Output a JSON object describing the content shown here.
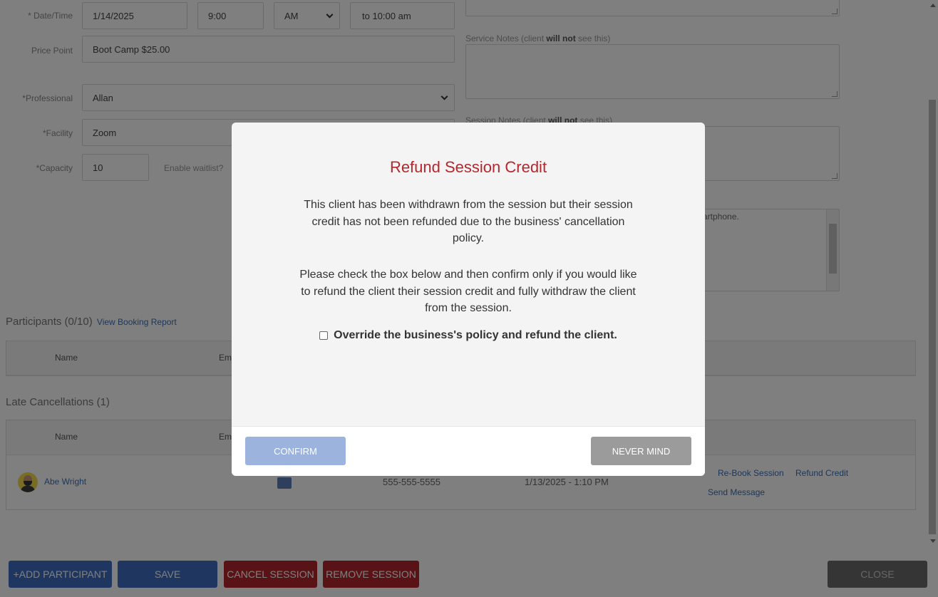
{
  "form": {
    "date_label": "* Date/Time",
    "date_value": "1/14/2025",
    "time_value": "9:00",
    "ampm_value": "AM",
    "end_time": "to 10:00 am",
    "price_label": "Price Point",
    "price_value": "Boot Camp $25.00",
    "professional_label": "*Professional",
    "professional_value": "Allan",
    "facility_label": "*Facility",
    "facility_value": "Zoom",
    "capacity_label": "*Capacity",
    "capacity_value": "10",
    "waitlist_label": "Enable waitlist?"
  },
  "notes": {
    "service_prefix": "Service Notes (client ",
    "service_bold": "will not",
    "service_suffix": " see this)",
    "session_prefix": "Session Notes (client ",
    "session_bold": "will not",
    "session_suffix": " see this)",
    "extra_text": "artphone."
  },
  "participants": {
    "title": "Participants (0/10)",
    "report_link": "View Booking Report",
    "col_name": "Name",
    "col_email": "Em"
  },
  "late_cancellations": {
    "title": "Late Cancellations (1)",
    "col_name": "Name",
    "col_email": "Em",
    "row": {
      "name": "Abe Wright",
      "phone": "555-555-5555",
      "date": "1/13/2025 - 1:10 PM",
      "rebook": "Re-Book Session",
      "refund": "Refund Credit",
      "message": "Send Message"
    }
  },
  "footer": {
    "add_participant": "+ADD PARTICIPANT",
    "save": "SAVE",
    "cancel_session": "CANCEL SESSION",
    "remove_session": "REMOVE SESSION",
    "close": "CLOSE"
  },
  "modal": {
    "title": "Refund Session Credit",
    "para1": "This client has been withdrawn from the session but their session credit has not been refunded due to the business' cancellation policy.",
    "para2": "Please check the box below and then confirm only if you would like to refund the client their session credit and fully withdraw the client from the session.",
    "override_label": "Override the business's policy and refund the client.",
    "confirm": "CONFIRM",
    "never_mind": "NEVER MIND"
  },
  "colors": {
    "accent_blue": "#3f6fc0",
    "danger_red": "#b3242b",
    "modal_title": "#b5272d"
  }
}
